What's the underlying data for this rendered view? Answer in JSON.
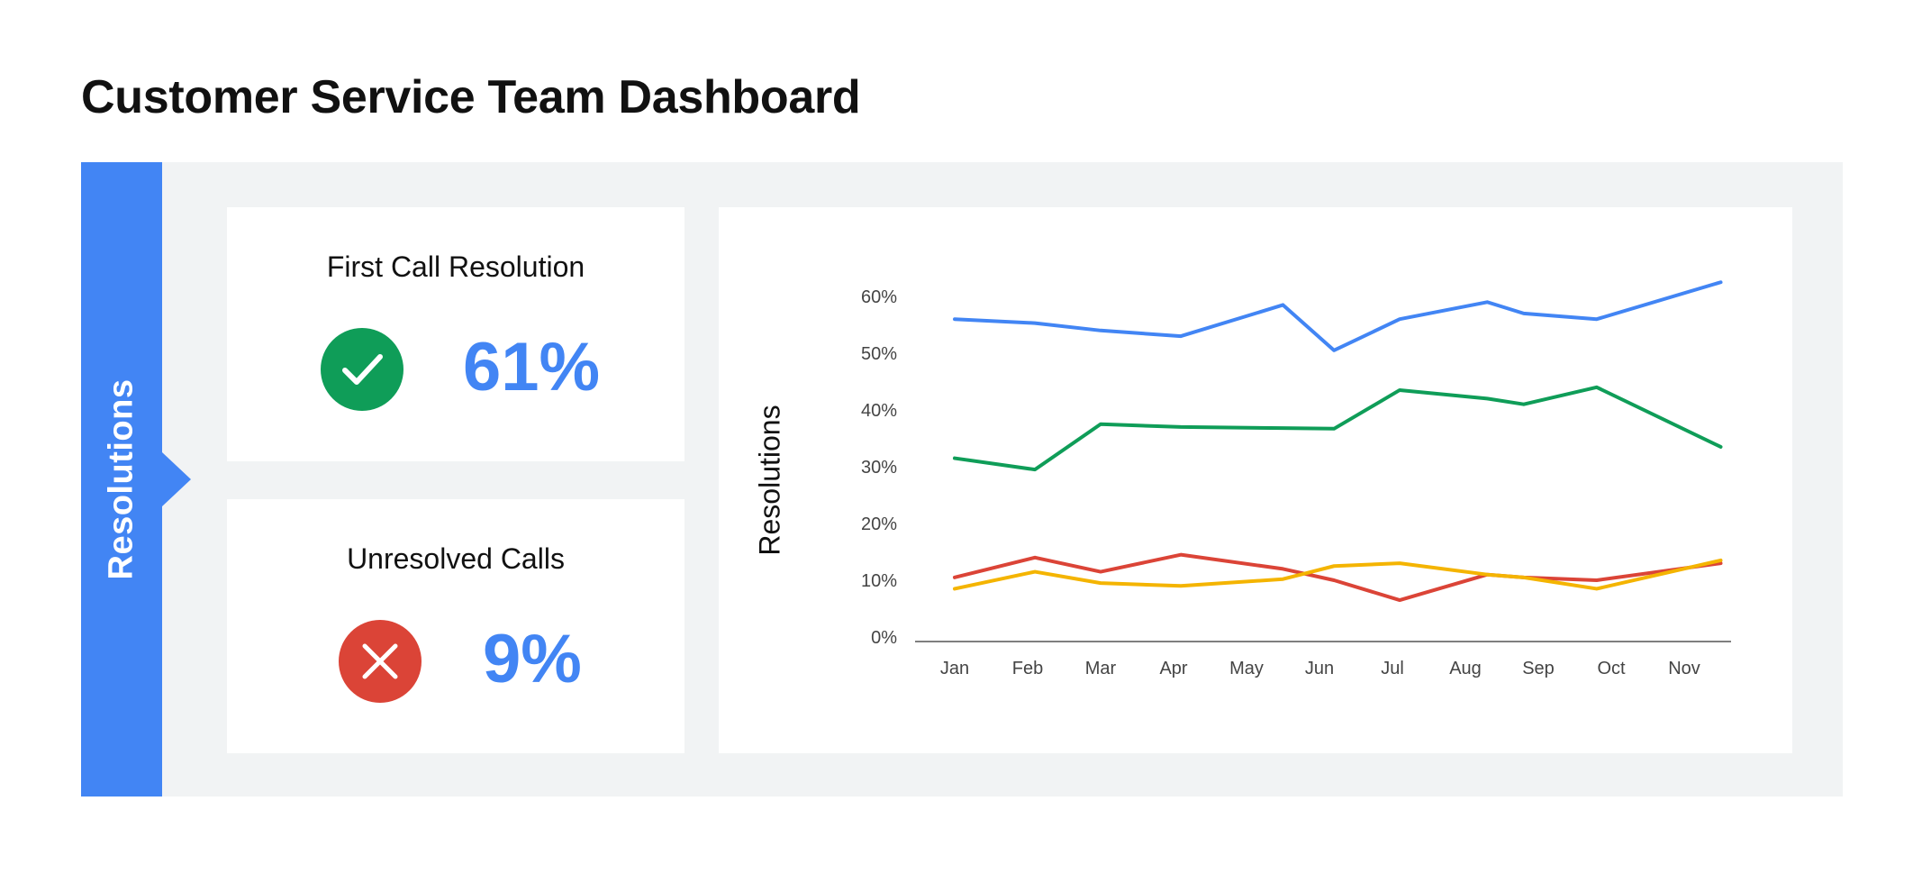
{
  "header": {
    "title": "Customer Service Team Dashboard"
  },
  "side_tab": {
    "label": "Resolutions"
  },
  "kpis": [
    {
      "title": "First Call Resolution",
      "value": "61%",
      "icon": "check-icon",
      "icon_color": "#0f9d58"
    },
    {
      "title": "Unresolved Calls",
      "value": "9%",
      "icon": "close-icon",
      "icon_color": "#db4437"
    }
  ],
  "colors": {
    "accent": "#4285f4",
    "panel_bg": "#f1f3f4"
  },
  "chart_data": {
    "type": "line",
    "categories": [
      "Jan",
      "Feb",
      "Mar",
      "Apr",
      "May",
      "Jun",
      "Jul",
      "Aug",
      "Sep",
      "Oct",
      "Nov"
    ],
    "x": [
      0,
      1.1,
      2,
      3.1,
      4.5,
      5.2,
      6.1,
      7.3,
      7.8,
      8.8,
      10.5
    ],
    "ylabel": "Resolutions",
    "yticks": [
      "0%",
      "10%",
      "20%",
      "30%",
      "40%",
      "50%",
      "60%"
    ],
    "ylim": [
      0,
      65
    ],
    "grid": false,
    "series": [
      {
        "color": "#4285f4",
        "values": [
          56,
          55.3,
          54,
          53,
          58.5,
          50.5,
          56,
          59,
          57,
          56,
          62.5
        ]
      },
      {
        "color": "#0f9d58",
        "values": [
          31.5,
          29.5,
          37.5,
          37,
          36.8,
          36.7,
          43.5,
          42,
          41,
          44,
          33.5
        ]
      },
      {
        "color": "#db4437",
        "values": [
          10.5,
          14,
          11.5,
          14.5,
          12,
          10,
          6.5,
          11,
          10.5,
          10,
          13
        ]
      },
      {
        "color": "#f4b400",
        "values": [
          8.5,
          11.5,
          9.5,
          9,
          10.2,
          12.5,
          13,
          11,
          10.5,
          8.5,
          13.5
        ]
      }
    ]
  }
}
